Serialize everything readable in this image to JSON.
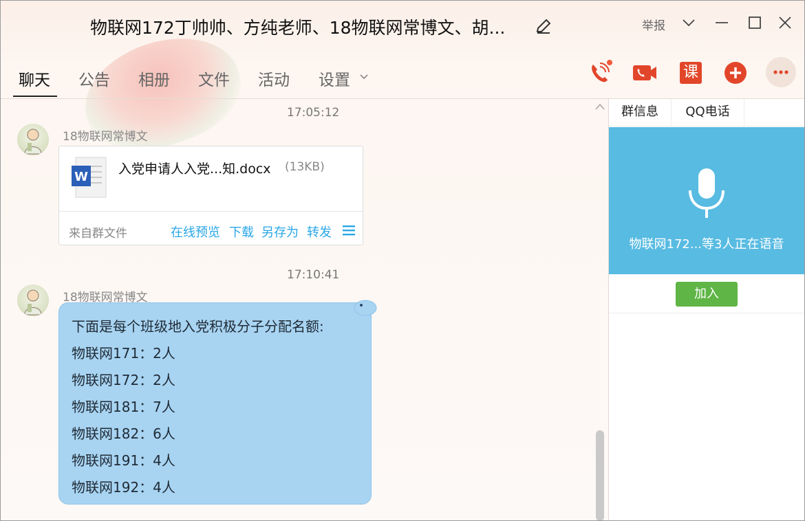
{
  "window": {
    "title": "物联网172丁帅帅、方纯老师、18物联网常博文、胡...",
    "report_label": "举报"
  },
  "nav": {
    "tabs": [
      {
        "label": "聊天"
      },
      {
        "label": "公告"
      },
      {
        "label": "相册"
      },
      {
        "label": "文件"
      },
      {
        "label": "活动"
      },
      {
        "label": "设置"
      }
    ]
  },
  "toolbar": {
    "call_icon": "phone-call-icon",
    "video_icon": "video-call-icon",
    "course_label": "课",
    "add_icon": "plus-icon",
    "more_icon": "more-icon"
  },
  "chat": {
    "messages": [
      {
        "time": "17:05:12",
        "sender": "18物联网常博文",
        "file": {
          "name": "入党申请人入党...知.docx",
          "size": "(13KB)",
          "source": "来自群文件",
          "actions": [
            "在线预览",
            "下载",
            "另存为",
            "转发"
          ]
        }
      },
      {
        "time": "17:10:41",
        "sender": "18物联网常博文",
        "lines": [
          "下面是每个班级地入党积极分子分配名额:",
          "物联网171：2人",
          "物联网172：2人",
          "物联网181：7人",
          "物联网182：6人",
          "物联网191：4人",
          "物联网192：4人"
        ]
      }
    ]
  },
  "panel": {
    "tabs": [
      {
        "label": "群信息"
      },
      {
        "label": "QQ电话"
      }
    ],
    "voice_status": "物联网172...等3人正在语音",
    "join_label": "加入"
  },
  "colors": {
    "bubble": "#a8d4f2",
    "link": "#2aa7e6",
    "voice_bg": "#58bbe2",
    "join_button": "#5fb545",
    "tool_red": "#e2462a"
  }
}
